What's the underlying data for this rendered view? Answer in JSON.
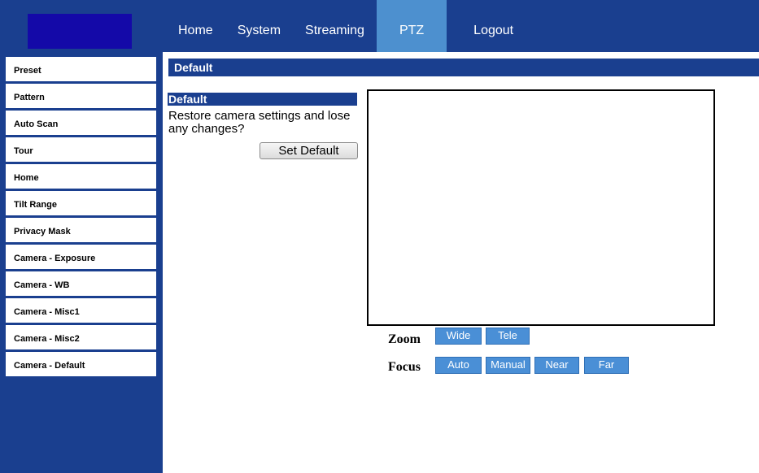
{
  "nav": {
    "items": [
      {
        "label": "Home"
      },
      {
        "label": "System"
      },
      {
        "label": "Streaming"
      },
      {
        "label": "PTZ"
      },
      {
        "label": "Logout"
      }
    ],
    "active": "PTZ"
  },
  "sidebar": {
    "items": [
      {
        "label": "Preset"
      },
      {
        "label": "Pattern"
      },
      {
        "label": "Auto Scan"
      },
      {
        "label": "Tour"
      },
      {
        "label": "Home"
      },
      {
        "label": "Tilt Range"
      },
      {
        "label": "Privacy Mask"
      },
      {
        "label": "Camera - Exposure"
      },
      {
        "label": "Camera - WB"
      },
      {
        "label": "Camera - Misc1"
      },
      {
        "label": "Camera - Misc2"
      },
      {
        "label": "Camera - Default"
      }
    ]
  },
  "page": {
    "title": "Default"
  },
  "default_section": {
    "title": "Default",
    "description": "Restore camera settings and lose any changes?",
    "button_label": "Set Default"
  },
  "controls": {
    "zoom_label": "Zoom",
    "zoom_wide": "Wide",
    "zoom_tele": "Tele",
    "focus_label": "Focus",
    "focus_auto": "Auto",
    "focus_manual": "Manual",
    "focus_near": "Near",
    "focus_far": "Far"
  },
  "colors": {
    "nav_bg": "#1a3f8f",
    "nav_active": "#4d90cf",
    "logo": "#1409a8",
    "ptz_button": "#4a8fd6"
  }
}
